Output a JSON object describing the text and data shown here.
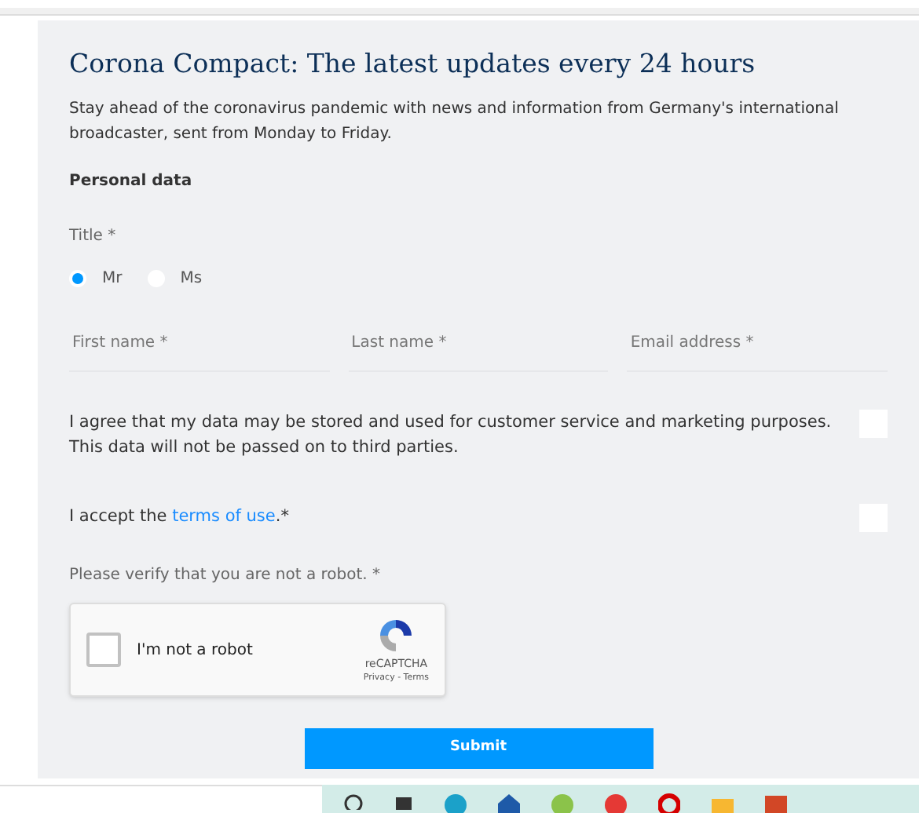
{
  "heading": "Corona Compact: The latest updates every 24 hours",
  "description": "Stay ahead of the coronavirus pandemic with news and information from Germany's international broadcaster, sent from Monday to Friday.",
  "section": "Personal data",
  "title_field": {
    "label": "Title *",
    "options": [
      {
        "label": "Mr",
        "selected": true
      },
      {
        "label": "Ms",
        "selected": false
      }
    ]
  },
  "fields": [
    {
      "placeholder": "First name *"
    },
    {
      "placeholder": "Last name *"
    },
    {
      "placeholder": "Email address *"
    }
  ],
  "consents": [
    {
      "text": "I agree that my data may be stored and used for customer service and marketing purposes. This data will not be passed on to third parties.",
      "checked": false
    },
    {
      "text": "I accept the ",
      "link": "terms of use",
      "suffix": ".*",
      "checked": false
    }
  ],
  "captcha": {
    "prompt": "Please verify that you are not a robot. *",
    "label": "I'm not a robot",
    "checked": false,
    "brand": "reCAPTCHA",
    "links": "Privacy - Terms"
  },
  "submit": "Submit"
}
